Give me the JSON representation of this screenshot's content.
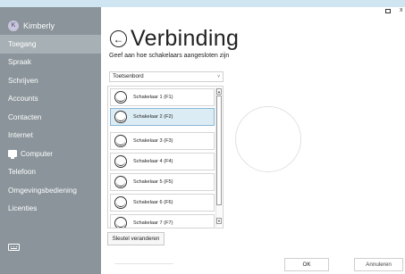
{
  "window": {
    "close_label": "x"
  },
  "sidebar": {
    "user": {
      "initial": "K",
      "name": "Kimberly"
    },
    "items": [
      {
        "label": "Toegang",
        "active": true
      },
      {
        "label": "Spraak"
      },
      {
        "label": "Schrijven"
      },
      {
        "label": "Accounts"
      },
      {
        "label": "Contacten"
      },
      {
        "label": "Internet"
      },
      {
        "label": "Computer",
        "icon": "computer-icon"
      },
      {
        "label": "Telefoon"
      },
      {
        "label": "Omgevingsbediening"
      },
      {
        "label": "Licenties"
      }
    ],
    "bottom_icon": "keyboard-icon"
  },
  "header": {
    "back_glyph": "←",
    "title": "Verbinding",
    "subtitle": "Geef aan hoe schakelaars aangesloten zijn"
  },
  "connection_select": {
    "value": "Toetsenbord",
    "chevron": "˅"
  },
  "switch_list": {
    "items": [
      {
        "label": "Schakelaar 1 (F1)"
      },
      {
        "label": "Schakelaar 2 (F2)",
        "selected": true
      },
      {
        "label": "Schakelaar 3 (F3)"
      },
      {
        "label": "Schakelaar 4 (F4)"
      },
      {
        "label": "Schakelaar 5 (F5)"
      },
      {
        "label": "Schakelaar 6 (F6)"
      },
      {
        "label": "Schakelaar 7 (F7)"
      }
    ],
    "scroll_up_glyph": "▲",
    "scroll_down_glyph": "▼"
  },
  "buttons": {
    "change_key": "Sleutel veranderen",
    "ok": "OK",
    "cancel": "Annuleren"
  }
}
